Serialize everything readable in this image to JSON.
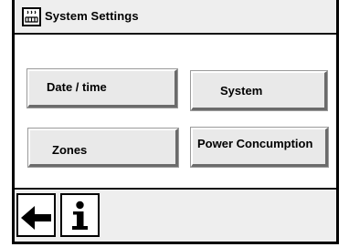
{
  "title": {
    "icon": "heater-icon",
    "text": "System Settings"
  },
  "buttons": {
    "date_time": "Date / time",
    "system": "System",
    "zones": "Zones",
    "power": "Power Concumption"
  },
  "footer": {
    "back_icon": "arrow-left-icon",
    "info_icon": "info-icon"
  }
}
